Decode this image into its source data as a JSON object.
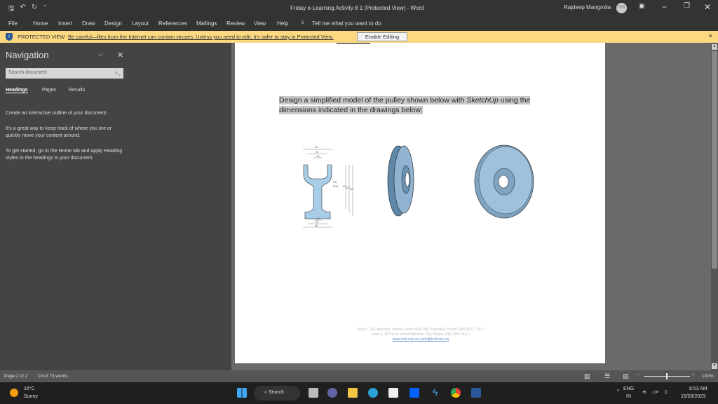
{
  "titlebar": {
    "title": "Friday e-Learning Activity 8 1 (Protected View)  -  Word",
    "user": "Rajdeep Mangrolia",
    "avatar": "RM"
  },
  "menu": {
    "items": [
      "File",
      "Home",
      "Insert",
      "Draw",
      "Design",
      "Layout",
      "References",
      "Mailings",
      "Review",
      "View",
      "Help"
    ],
    "tell_me": "Tell me what you want to do"
  },
  "protected": {
    "label": "PROTECTED VIEW",
    "message": "Be careful—files from the Internet can contain viruses. Unless you need to edit, it's safer to stay in Protected View.",
    "enable": "Enable Editing"
  },
  "nav": {
    "title": "Navigation",
    "search_placeholder": "Search document",
    "tabs": [
      "Headings",
      "Pages",
      "Results"
    ],
    "p1": "Create an interactive outline of your document.",
    "p2": "It's a great way to keep track of where you are or quickly move your content around.",
    "p3": "To get started, go to the Home tab and apply Heading styles to the headings in your document."
  },
  "doc": {
    "text_a": "Design a simplified model of the pulley shown below with ",
    "text_em": "SketchUp",
    "text_b": " using the dimensions indicated in the drawings below:",
    "footer1": "Level 7, 251 Adelaide Terrace, Perth 6000 WA, Australia | Phone: (08) 9221 1261 |",
    "footer2": "Level 3, 38 Currie Street Adelaide, SA | Phone: (08) 7200 3422 |",
    "footer3": "www.kcbt.edu.au | info@kcbt.edu.au",
    "dims": {
      "d1": "30",
      "d2": "20",
      "d3": "10",
      "r1": "R5",
      "r2": "R10",
      "v1": "50",
      "v2": "52",
      "v3": "55",
      "b1": "10",
      "b2": "20",
      "b3": "36"
    }
  },
  "status": {
    "page": "Page 2 of 2",
    "words": "19 of 73 words",
    "zoom": "100%"
  },
  "taskbar": {
    "temp": "16°C",
    "weather": "Sunny",
    "search": "Search",
    "lang1": "ENG",
    "lang2": "IN",
    "time": "8:53 AM",
    "date": "15/03/2023"
  }
}
